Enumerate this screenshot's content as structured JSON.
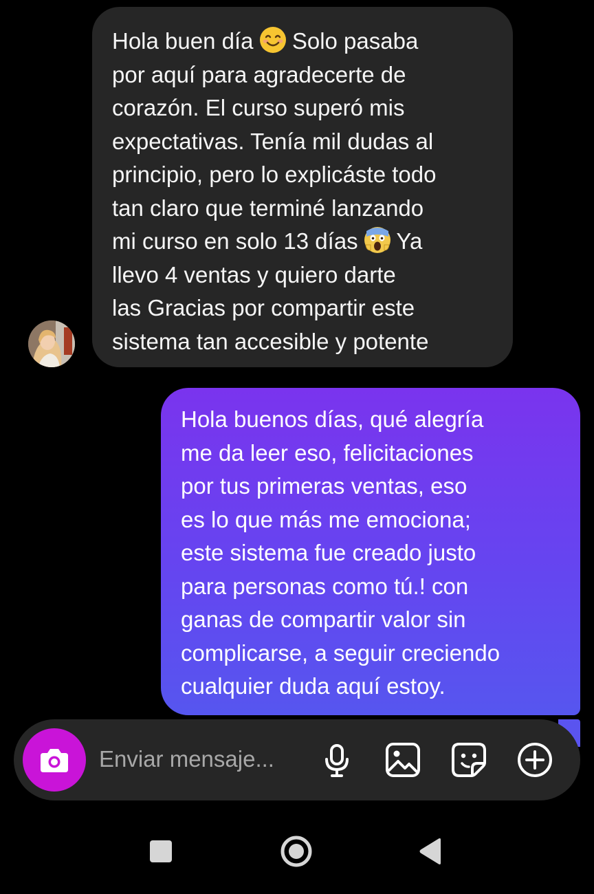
{
  "thread": {
    "incoming": {
      "sender_avatar_icon": "avatar-photo",
      "lines": [
        {
          "before": "Hola buen día ",
          "emoji": "smiling-face-emoji",
          "after": " Solo pasaba"
        },
        {
          "text": "por aquí para agradecerte de"
        },
        {
          "text": "corazón. El curso superó mis"
        },
        {
          "text": "expectativas. Tenía mil dudas al"
        },
        {
          "text": "principio, pero lo explicáste todo"
        },
        {
          "text": "tan claro que terminé lanzando"
        },
        {
          "before": "mi curso en solo 13 días ",
          "emoji": "screaming-face-emoji",
          "after": " Ya"
        },
        {
          "text": "llevo 4 ventas y quiero darte"
        },
        {
          "text": "las Gracias por compartir este"
        },
        {
          "text": "sistema tan accesible y potente"
        }
      ]
    },
    "outgoing": {
      "lines": [
        "Hola buenos días, qué alegría",
        "me da leer eso, felicitaciones",
        "por tus primeras ventas, eso",
        "es lo que más me emociona;",
        "este sistema fue creado justo",
        "para personas como tú.!  con",
        "ganas de compartir valor sin",
        "complicarse, a seguir creciendo",
        "cualquier duda aquí estoy."
      ]
    }
  },
  "composer": {
    "camera_icon": "camera-icon",
    "placeholder": "Enviar mensaje...",
    "value": "",
    "tools": [
      "microphone-icon",
      "image-icon",
      "sticker-icon",
      "add-circle-icon"
    ]
  },
  "navbar": {
    "buttons": [
      "recents-square-icon",
      "home-circle-icon",
      "back-triangle-icon"
    ]
  },
  "colors": {
    "background": "#000000",
    "incoming_bubble": "#262626",
    "outgoing_bubble_top": "#7a34ee",
    "outgoing_bubble_bottom": "#5656ef",
    "camera_button": "#c914d8",
    "composer": "#262626"
  }
}
